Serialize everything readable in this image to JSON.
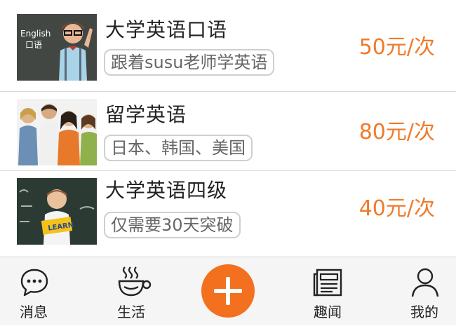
{
  "courses": [
    {
      "title": "大学英语口语",
      "tag": "跟着susu老师学英语",
      "price": "50元/次",
      "thumb_caption_1": "English",
      "thumb_caption_2": "口语"
    },
    {
      "title": "留学英语",
      "tag": "日本、韩国、美国",
      "price": "80元/次"
    },
    {
      "title": "大学英语四级",
      "tag": "仅需要30天突破",
      "price": "40元/次",
      "sign_text": "LEARN"
    }
  ],
  "tabbar": {
    "tabs": [
      {
        "label": "消息",
        "icon": "chat-bubble-icon"
      },
      {
        "label": "生活",
        "icon": "coffee-cup-icon"
      },
      {
        "label": "趣闻",
        "icon": "newspaper-icon"
      },
      {
        "label": "我的",
        "icon": "person-icon"
      }
    ],
    "add_icon": "plus-icon"
  },
  "colors": {
    "price": "#f07a2a",
    "fab": "#f3701f",
    "divider": "#d9d9d9"
  }
}
